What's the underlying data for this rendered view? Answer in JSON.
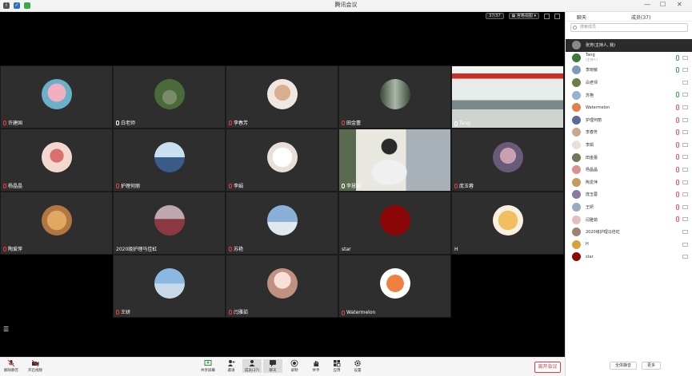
{
  "window": {
    "title": "腾讯会议"
  },
  "video_top": {
    "view_label": "▦ 宫格视图 ▾",
    "record_label": "37/37"
  },
  "tiles": [
    {
      "name": "许建国",
      "mic": "muted",
      "avatar": "bunny-avatar"
    },
    {
      "name": "白老师",
      "mic": "on",
      "avatar": "garden-avatar"
    },
    {
      "name": "李春芳",
      "mic": "muted",
      "avatar": "girl-avatar"
    },
    {
      "name": "田金蕾",
      "mic": "muted",
      "avatar": "waterfall-avatar"
    },
    {
      "name": "Tang",
      "mic": "on",
      "avatar": "classroom-video"
    },
    {
      "name": "杨晶晶",
      "mic": "muted",
      "avatar": "pink-avatar"
    },
    {
      "name": "护理何丽",
      "mic": "muted",
      "avatar": "couple-avatar"
    },
    {
      "name": "李娟",
      "mic": "muted",
      "avatar": "cartoon-avatar"
    },
    {
      "name": "李慧娟",
      "mic": "on",
      "avatar": "camera-video"
    },
    {
      "name": "庞玉蓉",
      "mic": "muted",
      "avatar": "portrait-avatar"
    },
    {
      "name": "陶爱萍",
      "mic": "muted",
      "avatar": "cat-avatar"
    },
    {
      "name": "2020级护理马佳虹",
      "mic": "none",
      "avatar": "flowers-avatar"
    },
    {
      "name": "苏艳",
      "mic": "muted",
      "avatar": "beach-avatar"
    },
    {
      "name": "star",
      "mic": "none",
      "avatar": "red-avatar"
    },
    {
      "name": "H",
      "mic": "none",
      "avatar": "tiger-avatar"
    },
    {
      "name": "王妍",
      "mic": "muted",
      "avatar": "hand-avatar"
    },
    {
      "name": "闫雅茹",
      "mic": "muted",
      "avatar": "anime-girl-avatar"
    },
    {
      "name": "Watermelon",
      "mic": "muted",
      "avatar": "orange-avatar"
    }
  ],
  "toolbar": {
    "mute": "解除静音",
    "video": "开启视频",
    "share": "共享屏幕",
    "invite": "邀请",
    "members": "成员(37)",
    "chat": "聊天",
    "record": "录制",
    "hand": "举手",
    "apps": "应用",
    "settings": "设置",
    "end": "离开会议"
  },
  "panel": {
    "tab_chat": "聊天",
    "tab_members": "成员(37)",
    "search_placeholder": "搜索成员",
    "mute_all": "全体静音",
    "more": "更多",
    "members": [
      {
        "name": "张芳(主持人, 我)",
        "sub": "",
        "color": "#888888",
        "mic": "muted",
        "selected": true
      },
      {
        "name": "Tang",
        "sub": "(主持人)",
        "color": "#3a7a3a",
        "mic": "on"
      },
      {
        "name": "李晓敏",
        "sub": "",
        "color": "#7a9ab5",
        "mic": "on"
      },
      {
        "name": "白老师",
        "sub": "",
        "color": "#6b7d4a",
        "mic": "none"
      },
      {
        "name": "苏艳",
        "sub": "",
        "color": "#9ab0d0",
        "mic": "on"
      },
      {
        "name": "Watermelon",
        "sub": "",
        "color": "#e08050",
        "mic": "muted"
      },
      {
        "name": "护理何丽",
        "sub": "",
        "color": "#5a6a9a",
        "mic": "muted"
      },
      {
        "name": "李春芳",
        "sub": "",
        "color": "#c8a890",
        "mic": "muted"
      },
      {
        "name": "李娟",
        "sub": "",
        "color": "#e8e0d8",
        "mic": "muted"
      },
      {
        "name": "田金蕾",
        "sub": "",
        "color": "#6a7a5a",
        "mic": "muted"
      },
      {
        "name": "杨晶晶",
        "sub": "",
        "color": "#d89090",
        "mic": "muted"
      },
      {
        "name": "陶爱萍",
        "sub": "",
        "color": "#c89a60",
        "mic": "muted"
      },
      {
        "name": "庞玉蓉",
        "sub": "",
        "color": "#8a7aa0",
        "mic": "muted"
      },
      {
        "name": "王妍",
        "sub": "",
        "color": "#9aa8c0",
        "mic": "muted"
      },
      {
        "name": "闫雅茹",
        "sub": "",
        "color": "#e0c0c0",
        "mic": "muted"
      },
      {
        "name": "2020级护理马佳虹",
        "sub": "",
        "color": "#a08070",
        "mic": "none"
      },
      {
        "name": "H",
        "sub": "",
        "color": "#d8a040",
        "mic": "none"
      },
      {
        "name": "star",
        "sub": "",
        "color": "#8a0a0a",
        "mic": "none"
      }
    ]
  }
}
